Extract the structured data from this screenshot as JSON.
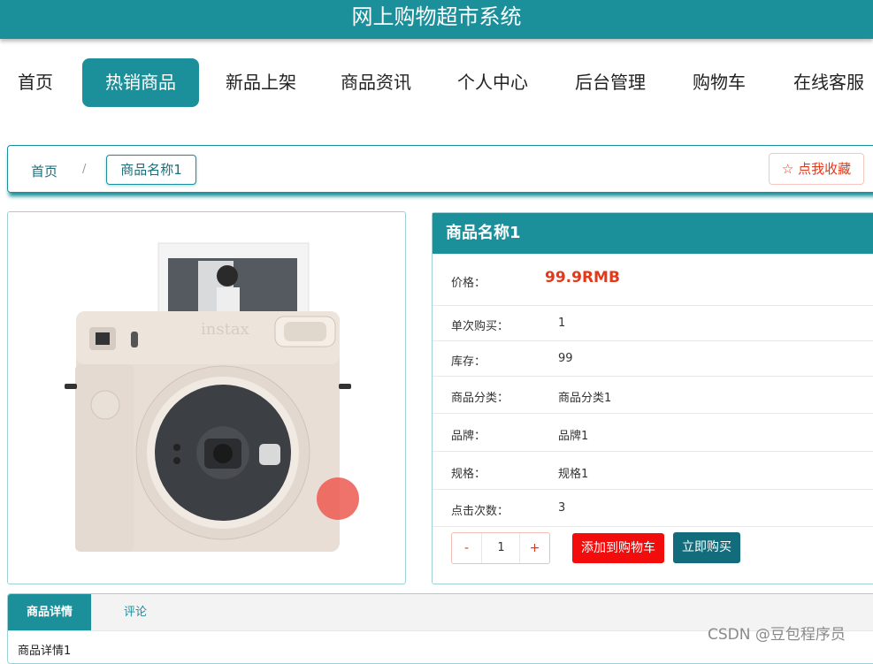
{
  "header": {
    "title": "网上购物超市系统"
  },
  "nav": {
    "items": [
      {
        "label": "首页",
        "active": false
      },
      {
        "label": "热销商品",
        "active": true
      },
      {
        "label": "新品上架",
        "active": false
      },
      {
        "label": "商品资讯",
        "active": false
      },
      {
        "label": "个人中心",
        "active": false
      },
      {
        "label": "后台管理",
        "active": false
      },
      {
        "label": "购物车",
        "active": false
      },
      {
        "label": "在线客服",
        "active": false
      }
    ]
  },
  "breadcrumb": {
    "home": "首页",
    "separator": "/",
    "current": "商品名称1"
  },
  "favorite_button": "☆ 点我收藏",
  "product": {
    "name": "商品名称1",
    "price_label": "价格：",
    "price": "99.9RMB",
    "rows": [
      {
        "label": "单次购买：",
        "value": "1"
      },
      {
        "label": "库存：",
        "value": "99"
      },
      {
        "label": "商品分类：",
        "value": "商品分类1"
      },
      {
        "label": "品牌：",
        "value": "品牌1"
      },
      {
        "label": "规格：",
        "value": "规格1"
      },
      {
        "label": "点击次数：",
        "value": "3"
      }
    ]
  },
  "purchase": {
    "minus": "-",
    "quantity": "1",
    "plus": "+",
    "add_to_cart": "添加到购物车",
    "buy_now": "立即购买"
  },
  "tabs": {
    "items": [
      {
        "label": "商品详情",
        "active": true
      },
      {
        "label": "评论",
        "active": false
      }
    ],
    "content": "商品详情1"
  },
  "watermark": "CSDN @豆包程序员",
  "colors": {
    "primary": "#1b8f9a",
    "price": "#e2391a",
    "cart_button": "#f20c0c",
    "buy_button": "#136c7c"
  }
}
